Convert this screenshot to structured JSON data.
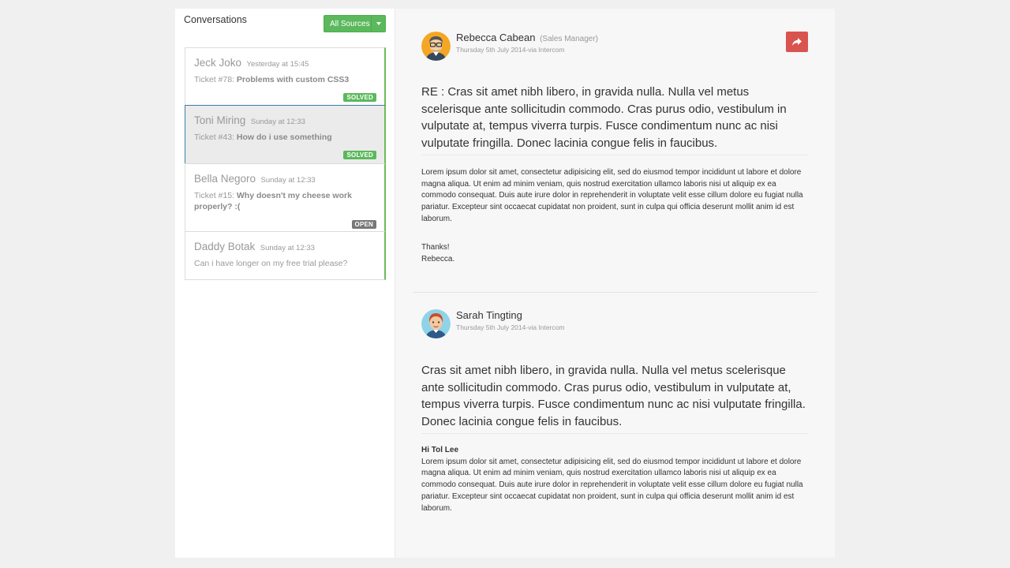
{
  "sidebar": {
    "title": "Conversations",
    "source_button": "All Sources",
    "conversations": [
      {
        "name": "Jeck Joko",
        "time": "Yesterday at 15:45",
        "ticket": "Ticket #78:",
        "subject": "Problems with custom CSS3",
        "status": "SOLVED"
      },
      {
        "name": "Toni Miring",
        "time": "Sunday at 12:33",
        "ticket": "Ticket #43:",
        "subject": "How do i use something",
        "status": "SOLVED"
      },
      {
        "name": "Bella Negoro",
        "time": "Sunday at 12:33",
        "ticket": "Ticket #15:",
        "subject": "Why doesn't my cheese work properly? :(",
        "status": "OPEN"
      },
      {
        "name": "Daddy Botak",
        "time": "Sunday at 12:33",
        "ticket": "",
        "subject": "Can i have longer on my free trial please?",
        "status": ""
      }
    ]
  },
  "messages": [
    {
      "sender": "Rebecca Cabean",
      "role": "(Sales Manager)",
      "meta": "Thursday 5th July 2014-via Intercom",
      "lead": "RE : Cras sit amet nibh libero, in gravida nulla. Nulla vel metus scelerisque ante sollicitudin commodo. Cras purus odio, vestibulum in vulputate at, tempus viverra turpis. Fusce condimentum nunc ac nisi vulputate fringilla. Donec lacinia congue felis in faucibus.",
      "body": "Lorem ipsum dolor sit amet, consectetur adipisicing elit, sed do eiusmod tempor incididunt ut labore et dolore magna aliqua. Ut enim ad minim veniam, quis nostrud exercitation ullamco laboris nisi ut aliquip ex ea commodo consequat. Duis aute irure dolor in reprehenderit in voluptate velit esse cillum dolore eu fugiat nulla pariatur. Excepteur sint occaecat cupidatat non proident, sunt in culpa qui officia deserunt mollit anim id est laborum.",
      "thanks": "Thanks!",
      "signature": "Rebecca."
    },
    {
      "sender": "Sarah Tingting",
      "meta": "Thursday 5th July 2014-via Intercom",
      "lead": "Cras sit amet nibh libero, in gravida nulla. Nulla vel metus scelerisque ante sollicitudin commodo. Cras purus odio, vestibulum in vulputate at, tempus viverra turpis. Fusce condimentum nunc ac nisi vulputate fringilla. Donec lacinia congue felis in faucibus.",
      "greeting": "Hi Tol Lee",
      "body": "Lorem ipsum dolor sit amet, consectetur adipisicing elit, sed do eiusmod tempor incididunt ut labore et dolore magna aliqua. Ut enim ad minim veniam, quis nostrud exercitation ullamco laboris nisi ut aliquip ex ea commodo consequat. Duis aute irure dolor in reprehenderit in voluptate velit esse cillum dolore eu fugiat nulla pariatur. Excepteur sint occaecat cupidatat non proident, sunt in culpa qui officia deserunt mollit anim id est laborum."
    }
  ],
  "icons": {
    "reply": "share-icon",
    "dropdown": "caret-down-icon"
  },
  "colors": {
    "success": "#5cb85c",
    "danger": "#d9534f",
    "muted": "#777777"
  }
}
